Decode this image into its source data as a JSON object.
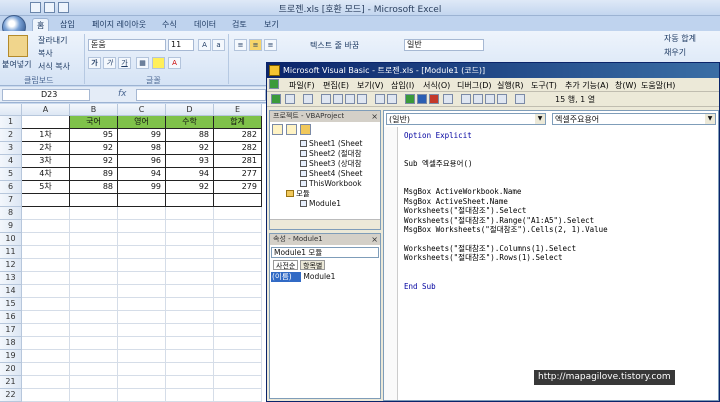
{
  "excel": {
    "title": "트로젠.xls [호환 모드] - Microsoft Excel",
    "tabs": [
      {
        "label": "홈"
      },
      {
        "label": "삽입"
      },
      {
        "label": "페이지 레이아웃"
      },
      {
        "label": "수식"
      },
      {
        "label": "데이터"
      },
      {
        "label": "검토"
      },
      {
        "label": "보기"
      }
    ],
    "ribbon": {
      "paste": "붙여넣기",
      "cut": "잘라내기",
      "copy": "복사",
      "format_painter": "서식 복사",
      "clipboard_group": "클립보드",
      "font_name": "돋움",
      "font_size": "11",
      "font_group": "글꼴",
      "wrap_text": "텍스트 줄 바꿈",
      "number_format": "일반",
      "autosum": "자동 합계",
      "fill": "채우기",
      "bold": "가",
      "italic": "가",
      "underline": "가"
    },
    "name_box": "D23",
    "fx": "fx",
    "columns": [
      "A",
      "B",
      "C",
      "D",
      "E"
    ],
    "rows": [
      "1",
      "2",
      "3",
      "4",
      "5",
      "6",
      "7",
      "8",
      "9",
      "10",
      "11",
      "12",
      "13",
      "14",
      "15",
      "16",
      "17",
      "18",
      "19",
      "20",
      "21",
      "22"
    ],
    "table": {
      "headers": [
        "",
        "국어",
        "영어",
        "수학",
        "합계"
      ],
      "data": [
        [
          "1차",
          "95",
          "99",
          "88",
          "282"
        ],
        [
          "2차",
          "92",
          "98",
          "92",
          "282"
        ],
        [
          "3차",
          "92",
          "96",
          "93",
          "281"
        ],
        [
          "4차",
          "89",
          "94",
          "94",
          "277"
        ],
        [
          "5차",
          "88",
          "99",
          "92",
          "279"
        ]
      ]
    }
  },
  "vbe": {
    "title": "Microsoft Visual Basic - 트로젠.xls - [Module1 (코드)]",
    "menu": [
      "파일(F)",
      "편집(E)",
      "보기(V)",
      "삽입(I)",
      "서식(O)",
      "디버그(D)",
      "실행(R)",
      "도구(T)",
      "추가 기능(A)",
      "창(W)",
      "도움말(H)"
    ],
    "position": "15 행, 1 열",
    "project_title": "프로젝트 - VBAProject",
    "project_items": [
      "Sheet1 (Sheet",
      "Sheet2 (절대참",
      "Sheet3 (상대참",
      "Sheet4 (Sheet",
      "ThisWorkbook",
      "모듈",
      "Module1"
    ],
    "props_title": "속성 - Module1",
    "props_combo": "Module1 모듈",
    "props_tabs": [
      "사전순",
      "항목별"
    ],
    "prop_key": "(이름)",
    "prop_value": "Module1",
    "object_combo": "(일반)",
    "proc_combo": "엑셀주요용어",
    "code": {
      "l1": "Option Explicit",
      "l2": "Sub 엑셀주요용어()",
      "l3": "MsgBox ActiveWorkbook.Name",
      "l4": "MsgBox ActiveSheet.Name",
      "l5": "Worksheets(\"절대참조\").Select",
      "l6": "Worksheets(\"절대참조\").Range(\"A1:A5\").Select",
      "l7": "MsgBox Worksheets(\"절대참조\").Cells(2, 1).Value",
      "l8": "Worksheets(\"절대참조\").Columns(1).Select",
      "l9": "Worksheets(\"절대참조\").Rows(1).Select",
      "l10": "End Sub"
    }
  },
  "watermark": "http://mapagilove.tistory.com"
}
